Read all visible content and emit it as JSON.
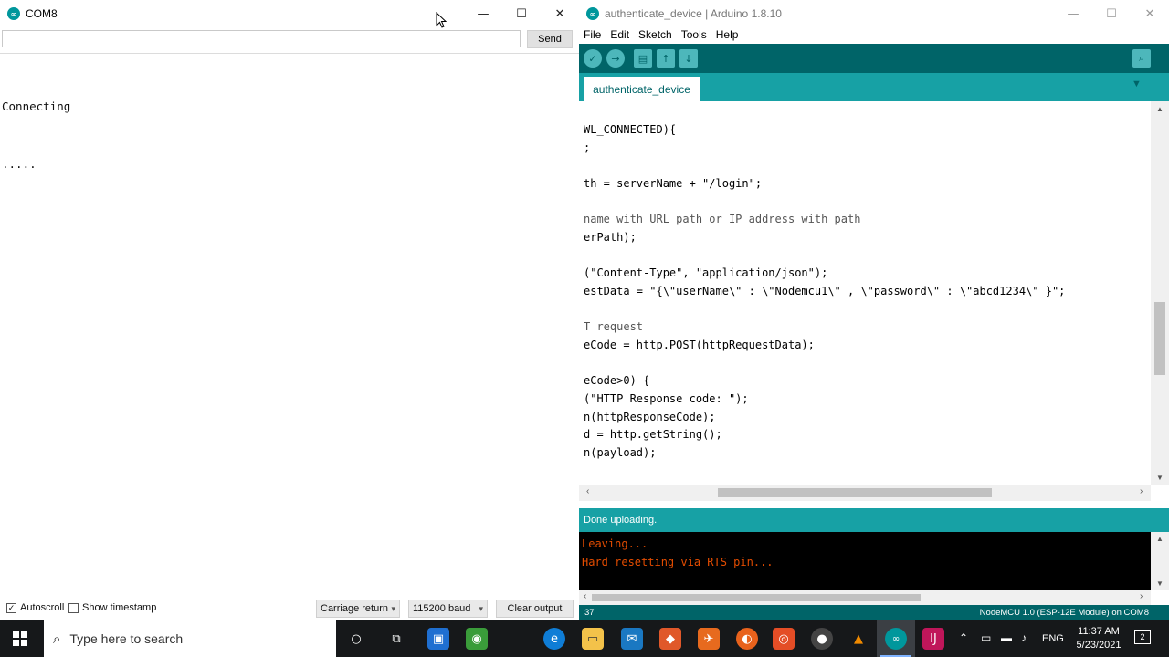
{
  "serial_monitor": {
    "title": "COM8",
    "input_value": "",
    "send_label": "Send",
    "output_lines": [
      "Connecting",
      "....."
    ],
    "autoscroll_label": "Autoscroll",
    "autoscroll_checked": true,
    "timestamp_label": "Show timestamp",
    "timestamp_checked": false,
    "line_ending": "Carriage return",
    "baud": "115200 baud",
    "clear_label": "Clear output"
  },
  "ide": {
    "title": "authenticate_device | Arduino 1.8.10",
    "menus": [
      "File",
      "Edit",
      "Sketch",
      "Tools",
      "Help"
    ],
    "tab_label": "authenticate_device",
    "code_lines": [
      "WL_CONNECTED){",
      ";",
      "",
      "th = serverName + \"/login\";",
      "",
      "name with URL path or IP address with path",
      "erPath);",
      "",
      "(\"Content-Type\", \"application/json\");",
      "estData = \"{\\\"userName\\\" : \\\"Nodemcu1\\\" , \\\"password\\\" : \\\"abcd1234\\\" }\";",
      "",
      "T request",
      "eCode = http.POST(httpRequestData);",
      "",
      "eCode>0) {",
      "(\"HTTP Response code: \");",
      "n(httpResponseCode);",
      "d = http.getString();",
      "n(payload);"
    ],
    "status": "Done uploading.",
    "console_lines": [
      "Leaving...",
      "Hard resetting via RTS pin..."
    ],
    "line_number": "37",
    "board_info": "NodeMCU 1.0 (ESP-12E Module) on COM8"
  },
  "taskbar": {
    "search_placeholder": "Type here to search",
    "lang": "ENG",
    "time": "11:37 AM",
    "date": "5/23/2021",
    "notification_count": "2"
  }
}
